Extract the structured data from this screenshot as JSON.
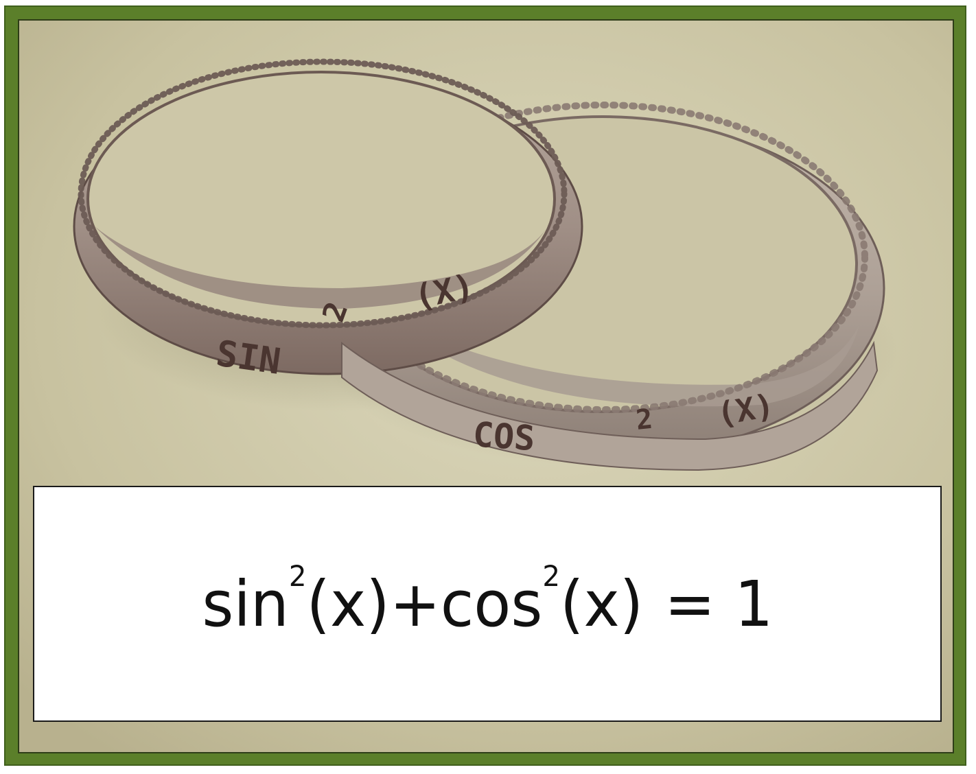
{
  "photo": {
    "ring_left_engraving": "SIN",
    "ring_left_power": "2",
    "ring_left_arg": "(X)",
    "ring_right_engraving": "COS",
    "ring_right_power": "2",
    "ring_right_arg": "(X)"
  },
  "caption": {
    "sin": "sin",
    "sin_power": "2",
    "sin_arg": "(x)+",
    "cos": "cos",
    "cos_power": "2",
    "cos_arg": "(x)",
    "equals": "= 1"
  },
  "colors": {
    "frame_green": "#5b7f2a",
    "photo_bg": "#cfc9a9",
    "ring_metal": "#9a8a80"
  }
}
